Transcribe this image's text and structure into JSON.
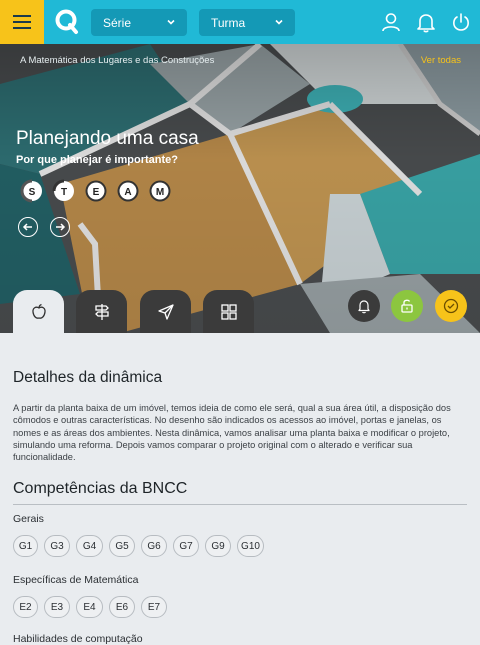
{
  "header": {
    "serie_label": "Série",
    "turma_label": "Turma"
  },
  "hero": {
    "collection_title": "A Matemática dos Lugares e das Construções",
    "see_all_label": "Ver todas",
    "title": "Planejando uma casa",
    "subtitle": "Por que planejar é importante?",
    "steam_letters": [
      "S",
      "T",
      "E",
      "A",
      "M"
    ]
  },
  "details": {
    "title": "Detalhes da dinâmica",
    "description": "A partir da planta baixa de um imóvel, temos ideia de como ele será, qual a sua área útil, a disposição dos cômodos e outras características. No desenho são indicados os acessos ao imóvel, portas e janelas, os nomes e as áreas dos ambientes. Nesta dinâmica, vamos analisar uma planta baixa e modificar o projeto, simulando uma reforma. Depois vamos comparar o projeto original com o alterado e verificar sua funcionalidade."
  },
  "bncc": {
    "title": "Competências  da BNCC",
    "general_label": "Gerais",
    "general_chips": [
      "G1",
      "G3",
      "G4",
      "G5",
      "G6",
      "G7",
      "G9",
      "G10"
    ],
    "math_label": "Específicas de Matemática",
    "math_chips": [
      "E2",
      "E3",
      "E4",
      "E6",
      "E7"
    ],
    "computing_label": "Habilidades de computação"
  },
  "colors": {
    "topbar": "#20b9d6",
    "accent_yellow": "#f7c31a",
    "unlock_green": "#8cc63f"
  }
}
